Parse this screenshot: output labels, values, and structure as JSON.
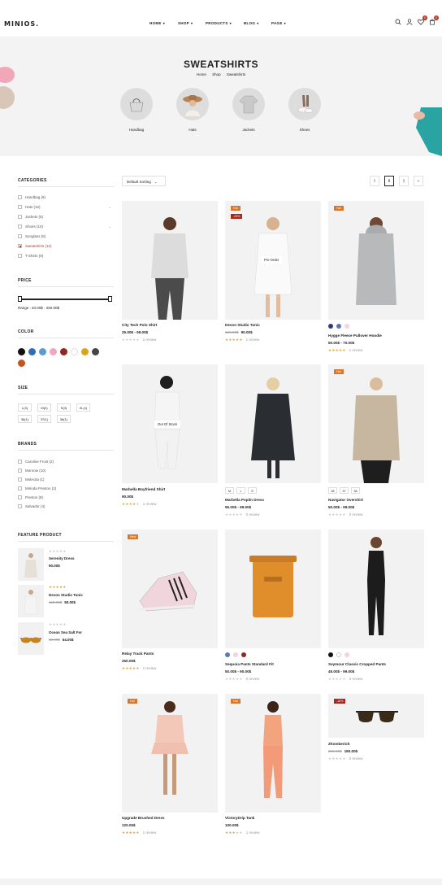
{
  "header": {
    "logo": "MINIOS.",
    "nav": [
      {
        "label": "HOME"
      },
      {
        "label": "SHOP"
      },
      {
        "label": "PRODUCTS"
      },
      {
        "label": "BLOG"
      },
      {
        "label": "PAGE"
      }
    ],
    "wishlist_count": "0",
    "cart_count": "0"
  },
  "hero": {
    "title": "SWEATSHIRTS",
    "breadcrumb": [
      "Home",
      "Shop",
      "Sweatshirts"
    ],
    "categories": [
      "Handbag",
      "Hats",
      "Jackets",
      "Shoes"
    ]
  },
  "sidebar": {
    "categories_title": "CATEGORIES",
    "categories": [
      {
        "label": "Handbag (8)"
      },
      {
        "label": "Hats (10)"
      },
      {
        "label": "Jackets (5)"
      },
      {
        "label": "Shoes (10)"
      },
      {
        "label": "Sunglass (5)"
      },
      {
        "label": "Sweatshirts (12)"
      },
      {
        "label": "T-Shirts (9)"
      }
    ],
    "price_title": "PRICE",
    "price_range": "Range : 40.00$ - 250.00$",
    "color_title": "COLOR",
    "colors": [
      "#111111",
      "#2f6fb0",
      "#5c9bd1",
      "#f2a6bf",
      "#8b2a1f",
      "#ffffff",
      "#d7a41c",
      "#454545",
      "#c2561f"
    ],
    "size_title": "SIZE",
    "sizes": [
      "L(3)",
      "M(2)",
      "S(3)",
      "XL(1)",
      "36(1)",
      "37(1)",
      "38(1)"
    ],
    "brands_title": "BRANDS",
    "brands": [
      "Caroline Frost (2)",
      "Monrow (10)",
      "Molecita (1)",
      "Mirinda Preston (2)",
      "Prestos (8)",
      "Salvador (4)"
    ],
    "feature_title": "FEATURE PRODUCT",
    "feature": [
      {
        "name": "Serenity Dress",
        "price": "90.00$",
        "old": ""
      },
      {
        "name": "Devon Studio Tunic",
        "price": "90.00$",
        "old": "120.00$"
      },
      {
        "name": "Ocean Sea Salt For",
        "price": "54.00$",
        "old": "60.00$"
      }
    ]
  },
  "toolbar": {
    "sort_label": "Default Sorting"
  },
  "products": [
    {
      "name": "City Tech Polo Shirt",
      "price": "25.00$ - 99.00$",
      "old": "",
      "rating": 0,
      "reviews": "2 review"
    },
    {
      "name": "Devon Studio Tunic",
      "price": "90.00$",
      "old": "120.00$",
      "rating": 5,
      "reviews": "1 review",
      "tags": [
        "Hot",
        "-25%"
      ],
      "overlay": "Pre Order"
    },
    {
      "name": "Hygge Fleece Pullover Hoodie",
      "price": "50.00$ - 70.00$",
      "old": "",
      "rating": 5,
      "reviews": "1 review",
      "tags": [
        "Hot"
      ]
    },
    {
      "name": "Marbella Boyfriend Shirt",
      "price": "90.00$",
      "old": "",
      "rating": 4,
      "reviews": "1 review",
      "overlay": "Out Of Stock"
    },
    {
      "name": "Marbella Poplin Dress",
      "price": "55.00$ - 99.00$",
      "old": "",
      "rating": 0,
      "reviews": "0 review",
      "variants": [
        "M",
        "L",
        "S"
      ]
    },
    {
      "name": "Navigator Overshirt",
      "price": "50.00$ - 99.00$",
      "old": "",
      "rating": 0,
      "reviews": "0 review",
      "tags": [
        "Hot"
      ],
      "variants": [
        "36",
        "37",
        "38"
      ]
    },
    {
      "name": "Relay Track Pants",
      "price": "250.00$",
      "old": "",
      "rating": 5,
      "reviews": "1 review",
      "tags": [
        "New"
      ]
    },
    {
      "name": "Sequoia Pants Standard Fit",
      "price": "50.00$ - 90.00$",
      "old": "",
      "rating": 0,
      "reviews": "0 review"
    },
    {
      "name": "Seymour Classic Cropped Pants",
      "price": "45.00$ - 99.00$",
      "old": "",
      "rating": 0,
      "reviews": "0 review"
    },
    {
      "name": "Upgrade Brushed Dress",
      "price": "120.00$",
      "old": "",
      "rating": 5,
      "reviews": "1 review",
      "tags": [
        "Hot"
      ]
    },
    {
      "name": "VictoryDrip Tank",
      "price": "100.00$",
      "old": "",
      "rating": 3,
      "reviews": "1 review",
      "tags": [
        "Hot"
      ]
    },
    {
      "name": "Zhomberioh",
      "price": "180.00$",
      "old": "200.00$",
      "rating": 0,
      "reviews": "0 review",
      "tags": [
        "-10%"
      ]
    }
  ]
}
